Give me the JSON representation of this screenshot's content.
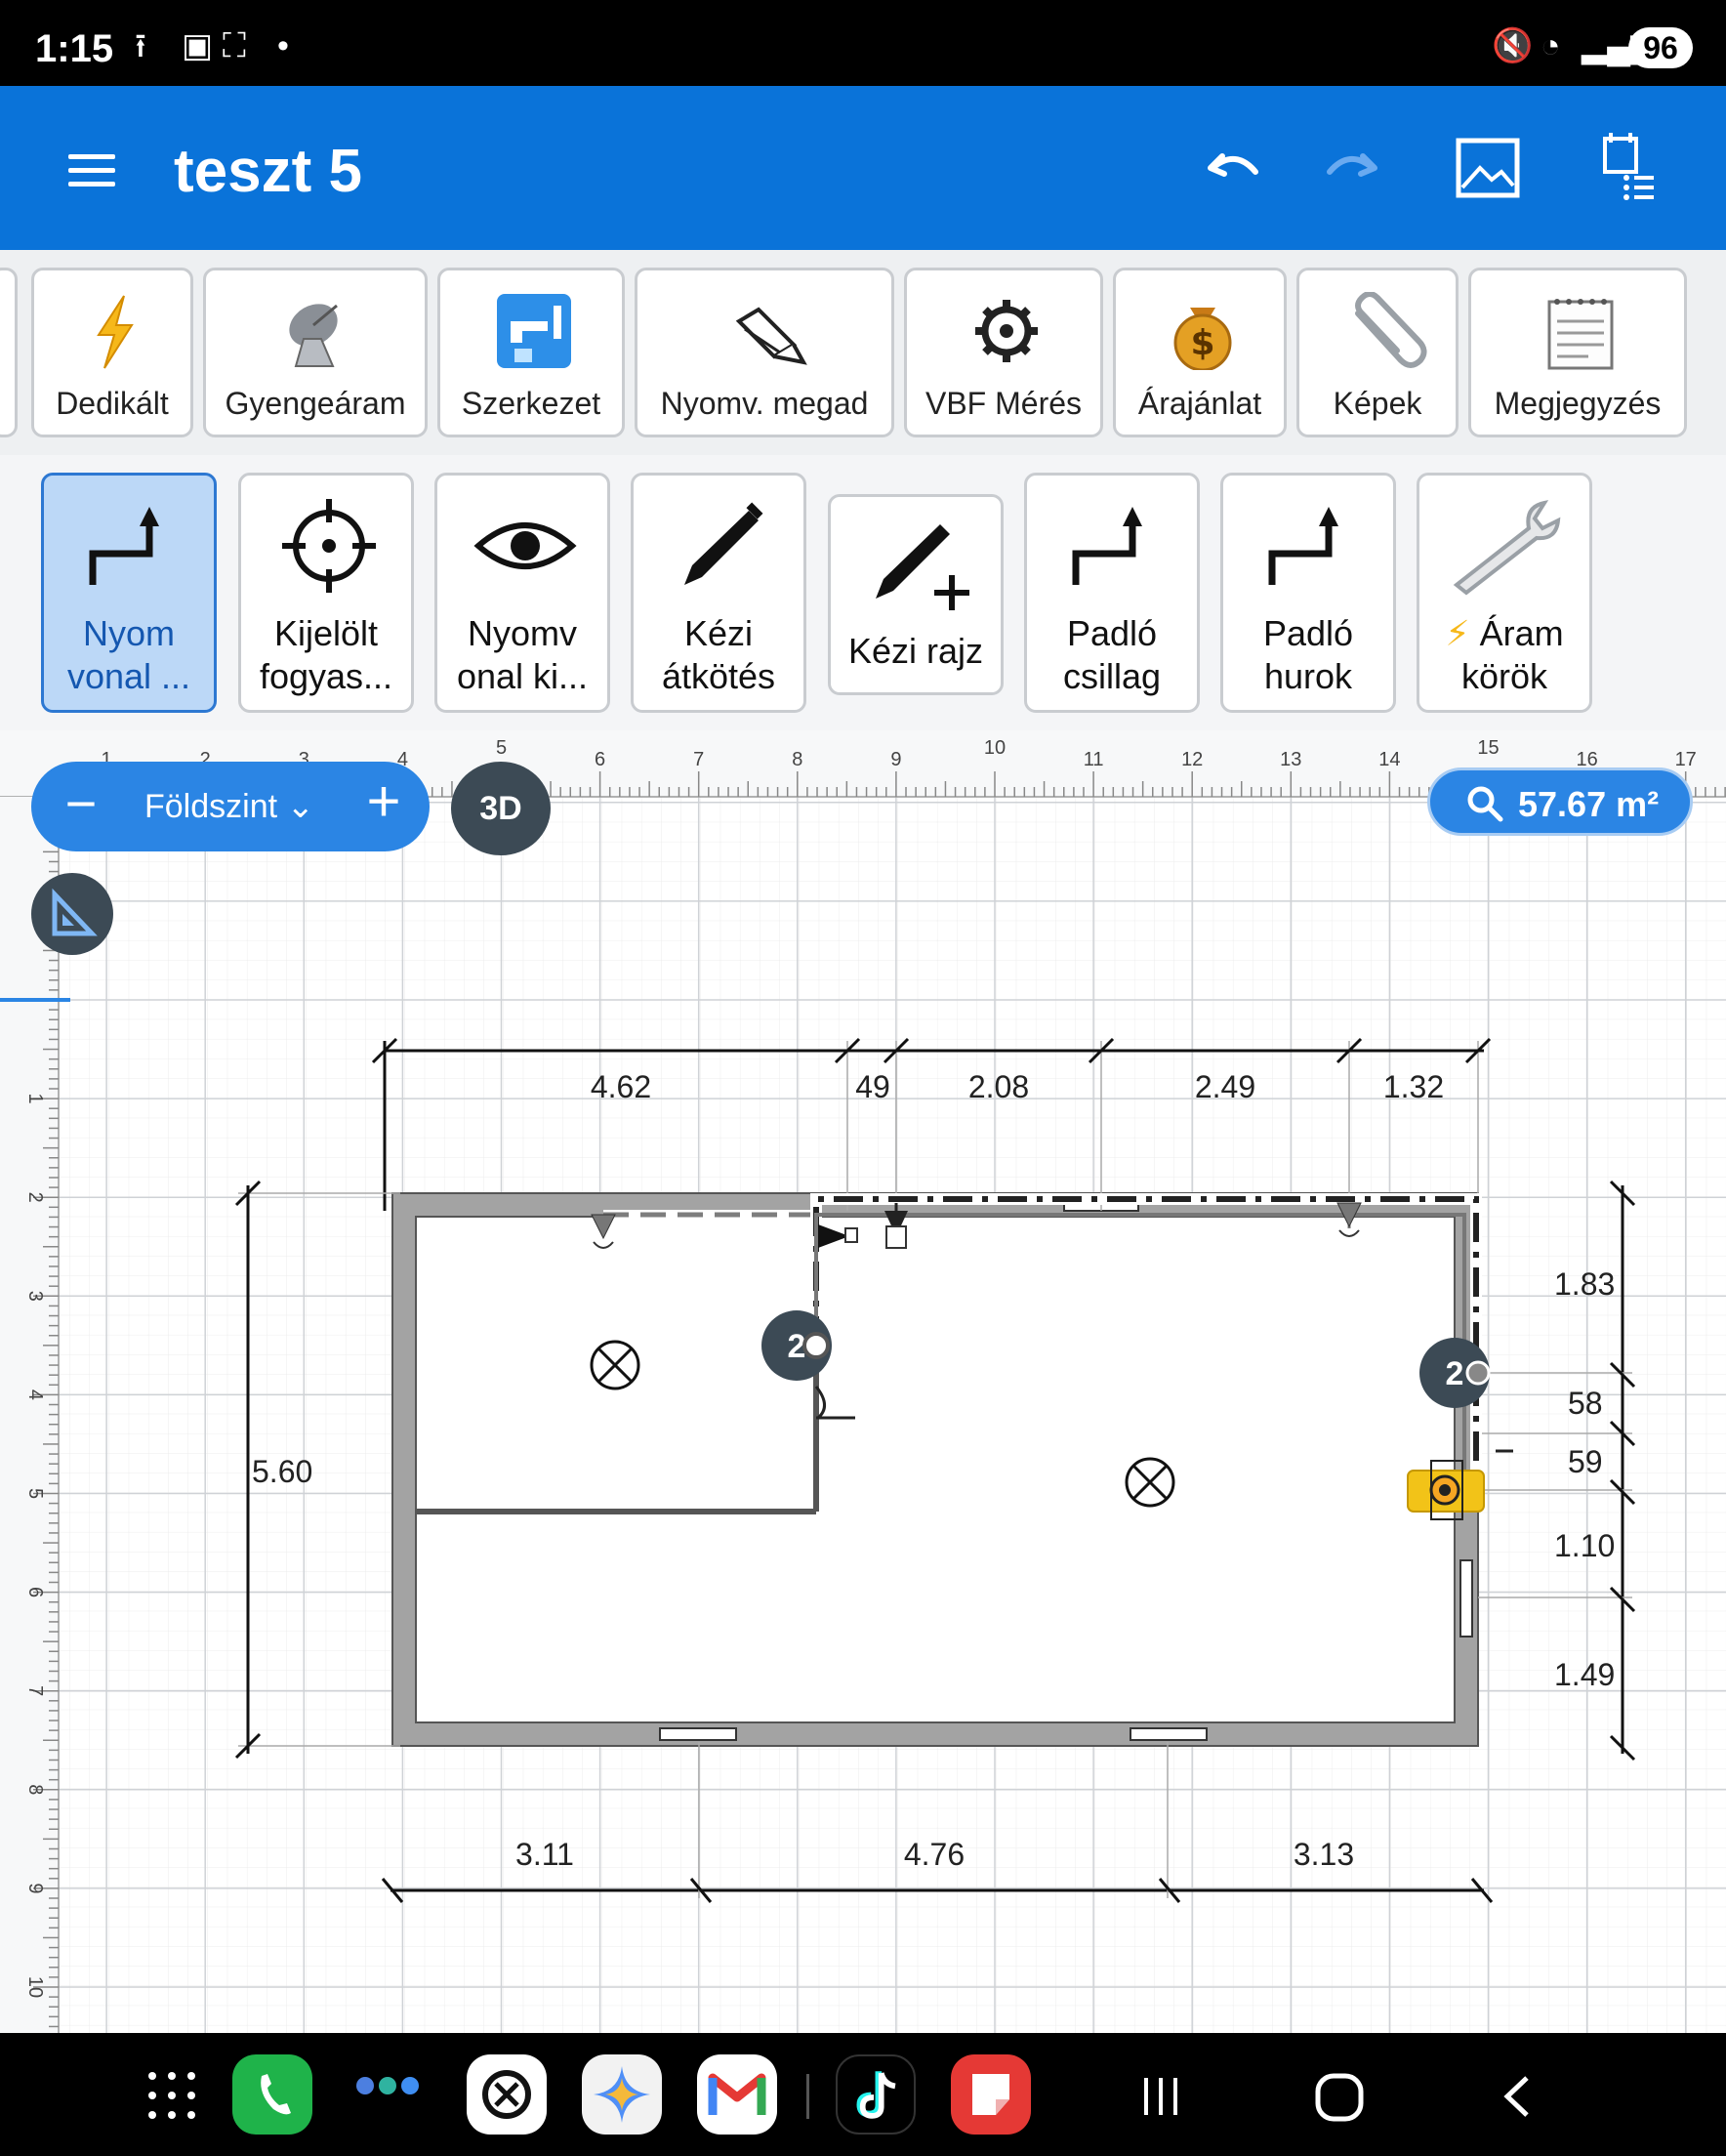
{
  "status_bar": {
    "time": "1:15",
    "battery": "96"
  },
  "app_bar": {
    "title": "teszt 5"
  },
  "toolbar_primary": [
    {
      "label": "Dedikált",
      "icon": "lightning-icon"
    },
    {
      "label": "Gyengeáram",
      "icon": "satellite-dish-icon"
    },
    {
      "label": "Szerkezet",
      "icon": "faucet-icon"
    },
    {
      "label": "Nyomv. megad",
      "icon": "pencil-icon"
    },
    {
      "label": "VBF Mérés",
      "icon": "gear-icon"
    },
    {
      "label": "Árajánlat",
      "icon": "money-bag-icon"
    },
    {
      "label": "Képek",
      "icon": "paperclip-icon"
    },
    {
      "label": "Megjegyzés",
      "icon": "notepad-icon"
    }
  ],
  "toolbar_tools": [
    {
      "line1": "Nyom",
      "line2": "vonal ...",
      "icon": "route-arrow-icon",
      "selected": true
    },
    {
      "line1": "Kijelölt",
      "line2": "fogyas...",
      "icon": "crosshair-icon",
      "selected": false
    },
    {
      "line1": "Nyomv",
      "line2": "onal ki...",
      "icon": "eye-icon",
      "selected": false
    },
    {
      "line1": "Kézi",
      "line2": "átkötés",
      "icon": "pen-icon",
      "selected": false
    },
    {
      "line1": "Kézi rajz",
      "line2": "",
      "icon": "pen-plus-icon",
      "selected": false
    },
    {
      "line1": "Padló",
      "line2": "csillag",
      "icon": "route-arrow-icon",
      "selected": false
    },
    {
      "line1": "Padló",
      "line2": "hurok",
      "icon": "route-arrow-icon",
      "selected": false
    },
    {
      "line1": "Áram",
      "line2": "körök",
      "icon": "wrench-icon",
      "selected": false
    }
  ],
  "canvas": {
    "floor_selector": "Földszint",
    "btn_3d": "3D",
    "area": "57.67 m²",
    "ruler_top": [
      "1",
      "2",
      "3",
      "4",
      "5",
      "6",
      "7",
      "8",
      "9",
      "10",
      "11",
      "12",
      "13",
      "14",
      "15",
      "16",
      "17"
    ],
    "ruler_left": [
      "1",
      "2",
      "3",
      "4",
      "5",
      "6",
      "7",
      "8",
      "9",
      "10"
    ],
    "dims_top": [
      "4.62",
      "49",
      "2.08",
      "2.49",
      "1.32"
    ],
    "dims_bottom": [
      "3.11",
      "4.76",
      "3.13"
    ],
    "dims_right": [
      "1.83",
      "58",
      "59",
      "1.10",
      "1.49"
    ],
    "dim_left": "5.60",
    "node_badge": "2"
  },
  "colors": {
    "app_bar": "#0a73d9",
    "accent": "#2b85e4",
    "wall": "#9e9e9e",
    "dark_badge": "#3c4a55"
  }
}
